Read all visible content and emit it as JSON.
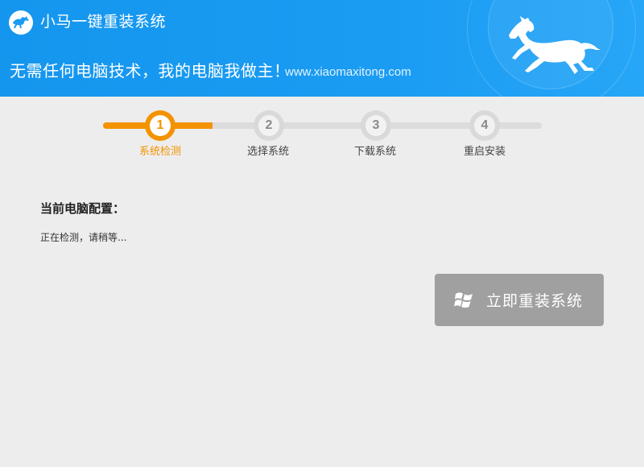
{
  "header": {
    "app_title": "小马一键重装系统",
    "slogan": "无需任何电脑技术，我的电脑我做主！",
    "site_url": "www.xiaomaxitong.com"
  },
  "steps": [
    {
      "number": "1",
      "label": "系统检测",
      "state": "active"
    },
    {
      "number": "2",
      "label": "选择系统",
      "state": "idle"
    },
    {
      "number": "3",
      "label": "下载系统",
      "state": "idle"
    },
    {
      "number": "4",
      "label": "重启安装",
      "state": "idle"
    }
  ],
  "progress_fraction": 0.25,
  "content": {
    "config_title": "当前电脑配置：",
    "status": "正在检测，请稍等..."
  },
  "install_button": {
    "label": "立即重装系统",
    "icon": "windows-icon"
  },
  "colors": {
    "header_blue": "#1a9cf3",
    "accent_orange": "#f39300",
    "button_gray": "#a0a0a0",
    "background": "#ededed"
  }
}
